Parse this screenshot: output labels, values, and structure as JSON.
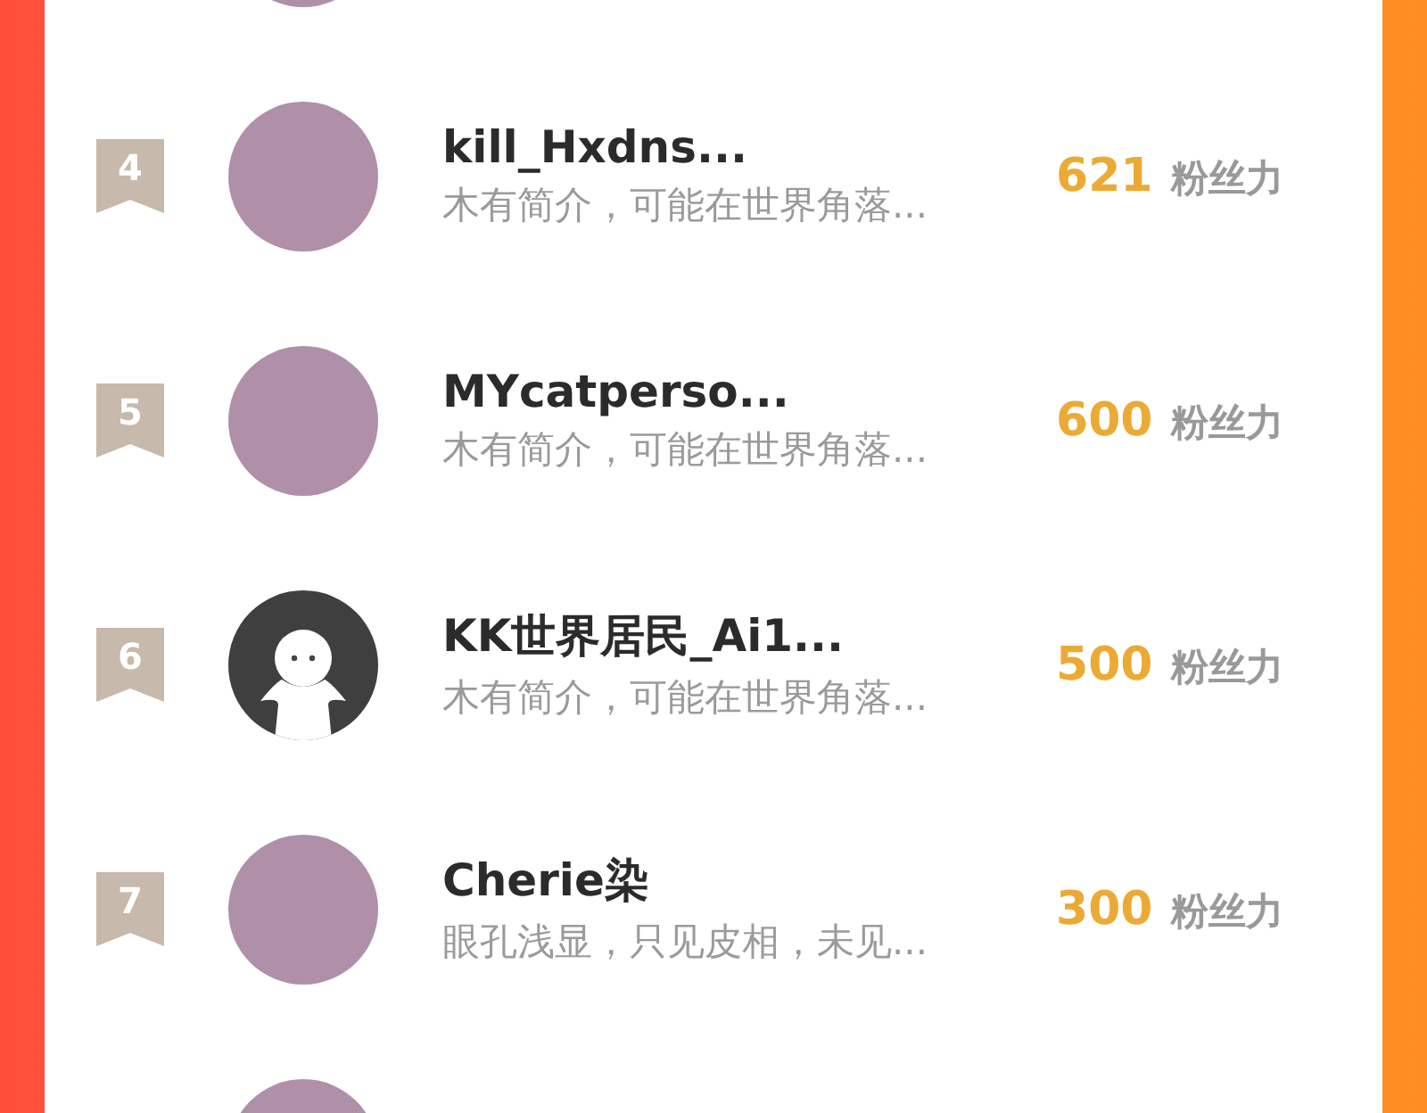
{
  "ranking": [
    {
      "kind": "photo"
    },
    {
      "rank": "4",
      "kind": "photo",
      "name": "kill_Hxdns...",
      "bio": "木有简介，可能在世界角落...",
      "fans": "621",
      "fans_label": "粉丝力"
    },
    {
      "rank": "5",
      "kind": "photo",
      "name": "MYcatperso...",
      "bio": "木有简介，可能在世界角落...",
      "fans": "600",
      "fans_label": "粉丝力"
    },
    {
      "rank": "6",
      "kind": "default",
      "name": "KK世界居民_Ai1...",
      "bio": "木有简介，可能在世界角落...",
      "fans": "500",
      "fans_label": "粉丝力"
    },
    {
      "rank": "7",
      "kind": "photo",
      "name": "Cherie染",
      "bio": "眼孔浅显，只见皮相，未见...",
      "fans": "300",
      "fans_label": "粉丝力"
    },
    {
      "kind": "photo"
    }
  ]
}
